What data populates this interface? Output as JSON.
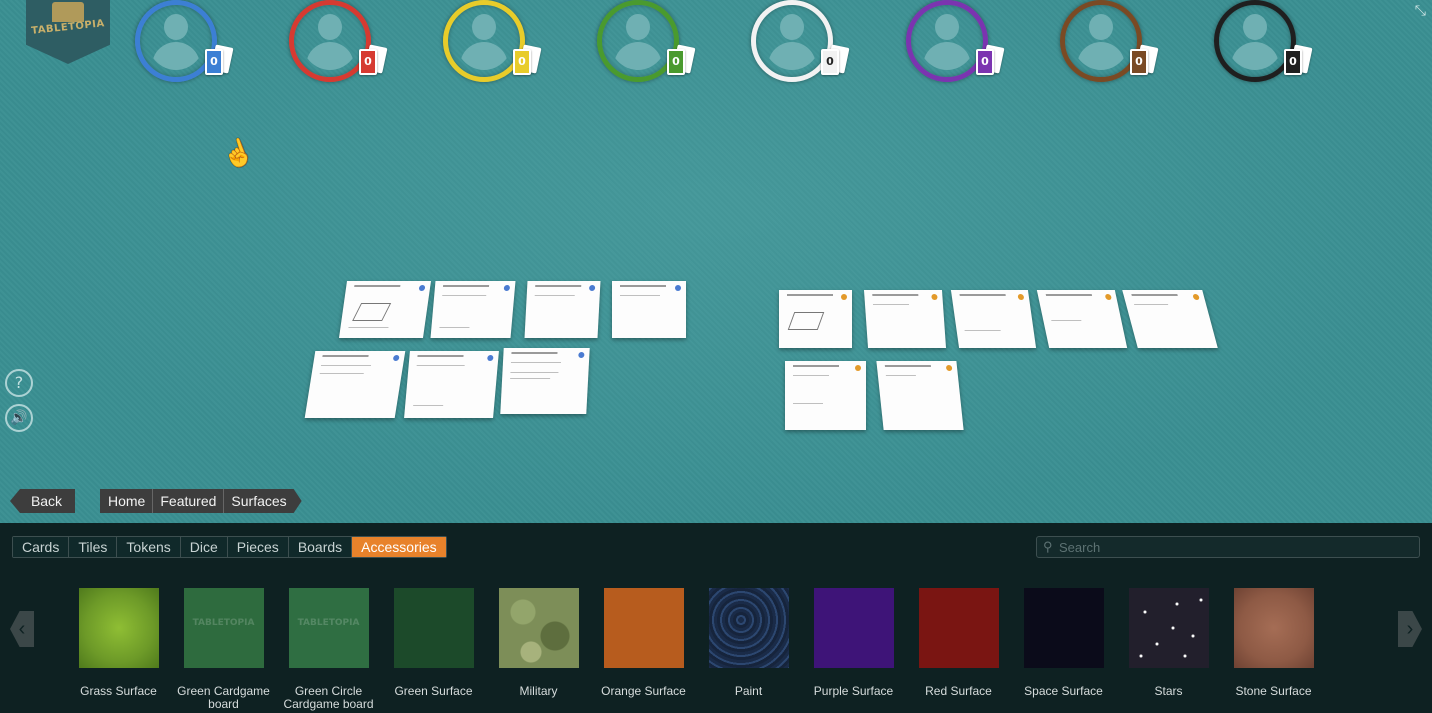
{
  "logo": {
    "text": "TABLETOPIA"
  },
  "players": [
    {
      "color": "#3c7fd4",
      "cards": "0"
    },
    {
      "color": "#d63a31",
      "cards": "0"
    },
    {
      "color": "#e8cc2a",
      "cards": "0"
    },
    {
      "color": "#4a9a2e",
      "cards": "0"
    },
    {
      "color": "#f2f2f2",
      "cards": "0"
    },
    {
      "color": "#7b34b0",
      "cards": "0"
    },
    {
      "color": "#7a4a24",
      "cards": "0"
    },
    {
      "color": "#1f1f1f",
      "cards": "0"
    }
  ],
  "nav": {
    "back_label": "Back",
    "breadcrumb": [
      "Home",
      "Featured",
      "Surfaces"
    ]
  },
  "tabs": [
    "Cards",
    "Tiles",
    "Tokens",
    "Dice",
    "Pieces",
    "Boards",
    "Accessories"
  ],
  "active_tab": "Accessories",
  "search": {
    "placeholder": "Search",
    "value": ""
  },
  "items": [
    {
      "label": "Grass Surface",
      "color": "#6d9a28"
    },
    {
      "label": "Green Cardgame board",
      "color": "#2e6b3e"
    },
    {
      "label": "Green Circle Cardgame board",
      "color": "#2f6e42"
    },
    {
      "label": "Green Surface",
      "color": "#1c4a2a"
    },
    {
      "label": "Military",
      "color": "#7d8e58"
    },
    {
      "label": "Orange Surface",
      "color": "#b75c1e"
    },
    {
      "label": "Paint",
      "color": "#1a2b48"
    },
    {
      "label": "Purple Surface",
      "color": "#3e1478"
    },
    {
      "label": "Red Surface",
      "color": "#7a1512"
    },
    {
      "label": "Space Surface",
      "color": "#0b0b1a"
    },
    {
      "label": "Stars",
      "color": "#221f2c"
    },
    {
      "label": "Stone Surface",
      "color": "#8e5a45"
    }
  ],
  "icons": {
    "help": "?",
    "sound": "🔊",
    "cursor": "☝",
    "fullscreen": "⤡",
    "prev": "‹",
    "next": "›",
    "search": "🔍"
  }
}
